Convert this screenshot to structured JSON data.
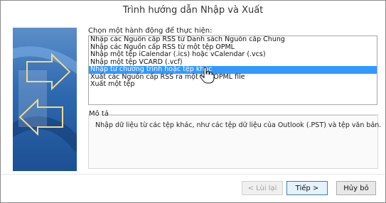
{
  "window": {
    "title": "Trình hướng dẫn Nhập và Xuất"
  },
  "prompt": "Chọn một hành động để thực hiện:",
  "actions": [
    "Nhập các Nguồn cấp RSS từ Danh sách Nguồn cấp Chung",
    "Nhập các Nguồn cấp RSS từ một tệp OPML",
    "Nhập một tệp iCalendar (.ics) hoặc vCalendar (.vcs)",
    "Nhập một tệp VCARD (.vcf)",
    "Nhập từ chương trình hoặc tệp khác",
    "Xuất các Nguồn cấp RSS ra một tệp OPML file",
    "Xuất một tệp"
  ],
  "selected_index": 4,
  "description": {
    "label": "Mô tả",
    "text": "Nhập dữ liệu từ các tệp khác, như các tệp dữ liệu của Outlook (.PST) và tệp văn bản."
  },
  "buttons": {
    "back": "< Lùi lại",
    "next": "Tiếp >",
    "cancel": "Hủy bỏ"
  },
  "colors": {
    "selection": "#3399ff",
    "art_blue": "#2e69b0",
    "next_border": "#3c7fb1"
  }
}
